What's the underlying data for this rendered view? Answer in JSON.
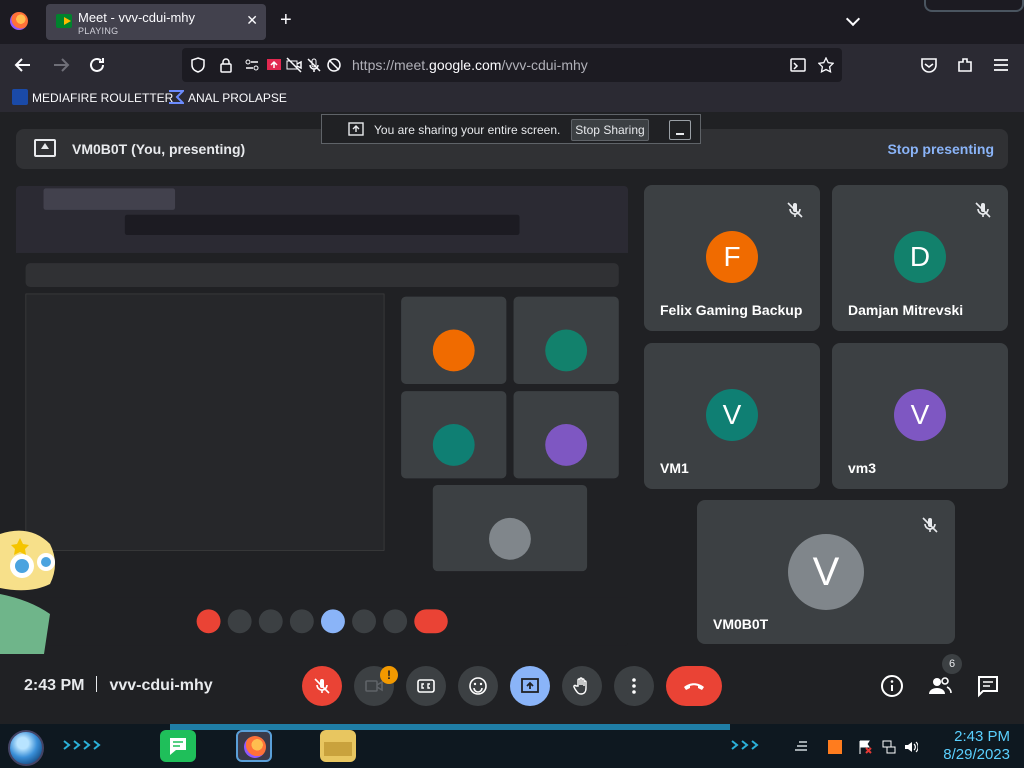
{
  "browser": {
    "tab": {
      "title": "Meet - vvv-cdui-mhy",
      "status": "PLAYING",
      "close": "✕"
    },
    "new_tab": "+",
    "url": {
      "prefix": "https://meet.",
      "host": "google.com",
      "path": "/vvv-cdui-mhy"
    },
    "bookmarks": [
      {
        "label": "MEDIAFIRE ROULETTER",
        "icon": "mediafire-icon"
      },
      {
        "label": "ANAL PROLAPSE",
        "icon": "bookmark-icon"
      }
    ]
  },
  "share_banner": {
    "message": "You are sharing your entire screen.",
    "stop_label": "Stop Sharing"
  },
  "presenting_bar": {
    "title": "VM0B0T (You, presenting)",
    "stop_label": "Stop presenting"
  },
  "participants": [
    {
      "name": "Felix Gaming Backup",
      "initial": "F",
      "color": "#f06b00"
    },
    {
      "name": "Damjan Mitrevski",
      "initial": "D",
      "color": "#12816c"
    },
    {
      "name": "VM1",
      "initial": "V",
      "color": "#0f7f73"
    },
    {
      "name": "vm3",
      "initial": "V",
      "color": "#7e57c2"
    },
    {
      "name": "VM0B0T",
      "initial": "V",
      "color": "#80868b"
    }
  ],
  "call": {
    "time": "2:43 PM",
    "meeting_code": "vvv-cdui-mhy",
    "camera_warning": "!",
    "people_count": "6"
  },
  "taskbar": {
    "time": "2:43 PM",
    "date": "8/29/2023"
  },
  "colors": {
    "accent": "#8ab4f8",
    "danger": "#ea4335",
    "tile": "#3c4043",
    "background": "#202124"
  }
}
